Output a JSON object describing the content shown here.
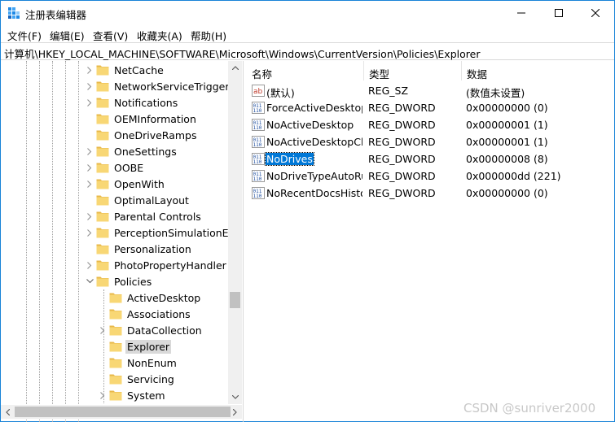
{
  "window": {
    "title": "注册表编辑器"
  },
  "menu": [
    {
      "label": "文件(F)"
    },
    {
      "label": "编辑(E)"
    },
    {
      "label": "查看(V)"
    },
    {
      "label": "收藏夹(A)"
    },
    {
      "label": "帮助(H)"
    }
  ],
  "address": "计算机\\HKEY_LOCAL_MACHINE\\SOFTWARE\\Microsoft\\Windows\\CurrentVersion\\Policies\\Explorer",
  "tree": [
    {
      "label": "NetCache",
      "expandable": true
    },
    {
      "label": "NetworkServiceTriggers",
      "expandable": true
    },
    {
      "label": "Notifications",
      "expandable": true
    },
    {
      "label": "OEMInformation",
      "expandable": false
    },
    {
      "label": "OneDriveRamps",
      "expandable": false
    },
    {
      "label": "OneSettings",
      "expandable": true
    },
    {
      "label": "OOBE",
      "expandable": true
    },
    {
      "label": "OpenWith",
      "expandable": true
    },
    {
      "label": "OptimalLayout",
      "expandable": false
    },
    {
      "label": "Parental Controls",
      "expandable": true
    },
    {
      "label": "PerceptionSimulationExt",
      "expandable": true
    },
    {
      "label": "Personalization",
      "expandable": false
    },
    {
      "label": "PhotoPropertyHandler",
      "expandable": true
    },
    {
      "label": "Policies",
      "expandable": true,
      "expanded": true
    },
    {
      "label": "ActiveDesktop",
      "expandable": false,
      "child": true
    },
    {
      "label": "Associations",
      "expandable": false,
      "child": true
    },
    {
      "label": "DataCollection",
      "expandable": true,
      "child": true
    },
    {
      "label": "Explorer",
      "expandable": false,
      "child": true,
      "selected": true
    },
    {
      "label": "NonEnum",
      "expandable": false,
      "child": true
    },
    {
      "label": "Servicing",
      "expandable": false,
      "child": true
    },
    {
      "label": "System",
      "expandable": true,
      "child": true
    }
  ],
  "columns": {
    "name": "名称",
    "type": "类型",
    "data": "数据"
  },
  "values": [
    {
      "name": "(默认)",
      "type": "REG_SZ",
      "data": "(数值未设置)",
      "icon": "string-value-icon"
    },
    {
      "name": "ForceActiveDesktopOn",
      "type": "REG_DWORD",
      "data": "0x00000000 (0)",
      "icon": "binary-value-icon"
    },
    {
      "name": "NoActiveDesktop",
      "type": "REG_DWORD",
      "data": "0x00000001 (1)",
      "icon": "binary-value-icon"
    },
    {
      "name": "NoActiveDesktopChanges",
      "type": "REG_DWORD",
      "data": "0x00000001 (1)",
      "icon": "binary-value-icon"
    },
    {
      "name": "NoDrives",
      "type": "REG_DWORD",
      "data": "0x00000008 (8)",
      "icon": "binary-value-icon",
      "selected": true
    },
    {
      "name": "NoDriveTypeAutoRun",
      "type": "REG_DWORD",
      "data": "0x000000dd (221)",
      "icon": "binary-value-icon"
    },
    {
      "name": "NoRecentDocsHistory",
      "type": "REG_DWORD",
      "data": "0x00000000 (0)",
      "icon": "binary-value-icon"
    }
  ],
  "watermark": "CSDN @sunriver2000",
  "colors": {
    "selection": "#0078d7",
    "folder": "#f8d775",
    "folder_dark": "#e8b84a",
    "border": "#1883d7"
  }
}
